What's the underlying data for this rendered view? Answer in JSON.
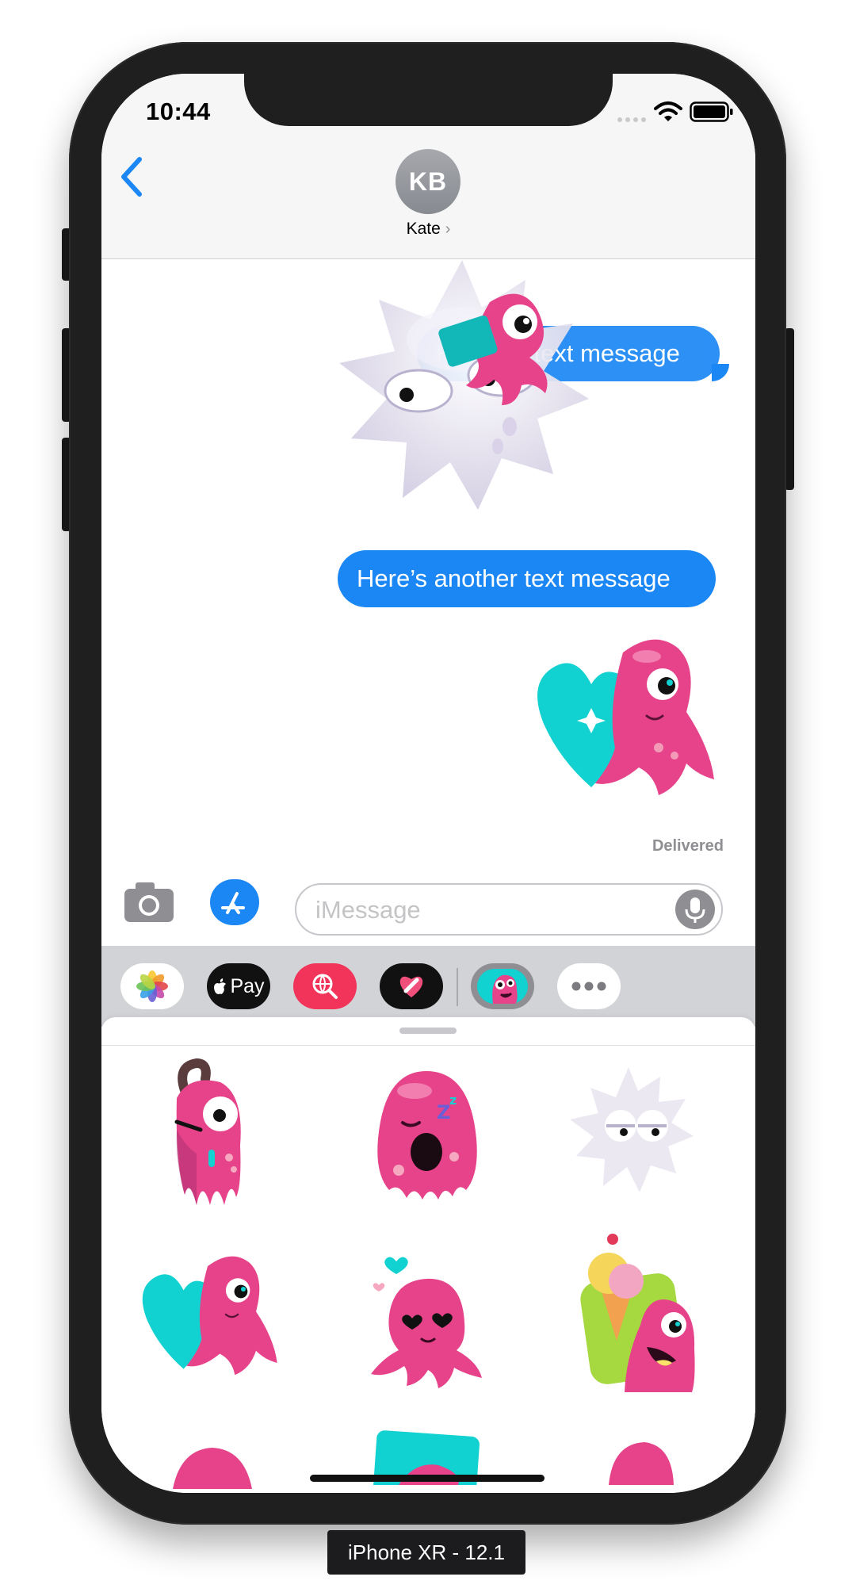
{
  "status_bar": {
    "time": "10:44"
  },
  "header": {
    "contact_initials": "KB",
    "contact_name": "Kate",
    "name_chevron": "›"
  },
  "messages": [
    {
      "text": "Here’s a text message",
      "partially_covered_by_sticker": true
    },
    {
      "text": "Here’s another text message"
    }
  ],
  "delivery_status": "Delivered",
  "composer": {
    "placeholder": "iMessage"
  },
  "app_drawer": {
    "apps": [
      {
        "name": "Photos",
        "icon": "photos-icon"
      },
      {
        "name": "Apple Pay",
        "label": "Pay",
        "icon": "apple-pay-icon"
      },
      {
        "name": "Images Search",
        "icon": "globe-search-icon"
      },
      {
        "name": "Digital Touch",
        "icon": "heart-touch-icon"
      },
      {
        "name": "Sticker Pack",
        "icon": "monster-sticker-icon",
        "selected": true
      },
      {
        "name": "More",
        "icon": "more-icon"
      }
    ]
  },
  "sticker_grid": [
    "worried-pink-monster",
    "sleepy-pink-blob",
    "grumpy-white-blob",
    "octopus-with-heart",
    "octopus-in-love",
    "monster-with-ice-cream"
  ],
  "device_label": "iPhone XR - 12.1",
  "colors": {
    "bubble_blue": "#1b87f5",
    "sticker_pink": "#e6438a",
    "sticker_teal": "#12d1d1",
    "drawer_grey": "#d2d3d7"
  }
}
